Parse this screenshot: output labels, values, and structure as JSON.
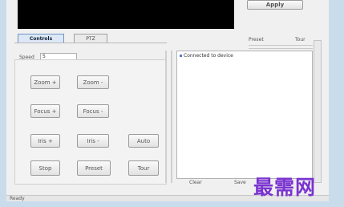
{
  "colors": {
    "frame": "#c9dcec",
    "video_background": "#000000",
    "watermark": "#7a33d0",
    "active_tab": "#dde8f6"
  },
  "top": {
    "corner_button_label": "Apply"
  },
  "tabs": [
    {
      "label": "Controls",
      "active": true
    },
    {
      "label": "PTZ"
    }
  ],
  "right_header": {
    "label_a": "Preset",
    "label_b": "Tour"
  },
  "panel": {
    "field_label": "Speed",
    "field_value": "5"
  },
  "controls": {
    "rows": [
      [
        "Zoom +",
        "Zoom -"
      ],
      [
        "Focus +",
        "Focus -"
      ],
      [
        "Iris +",
        "Iris -",
        "Auto"
      ],
      [
        "Stop",
        "Preset",
        "Tour"
      ]
    ]
  },
  "log": {
    "first_line": "Connected to device"
  },
  "bottom_buttons": {
    "left_label": "Clear",
    "right_label": "Save"
  },
  "status_bar": {
    "text": "Ready"
  },
  "watermark": {
    "text": "最需网"
  },
  "icons": [
    "log-entry-icon"
  ]
}
